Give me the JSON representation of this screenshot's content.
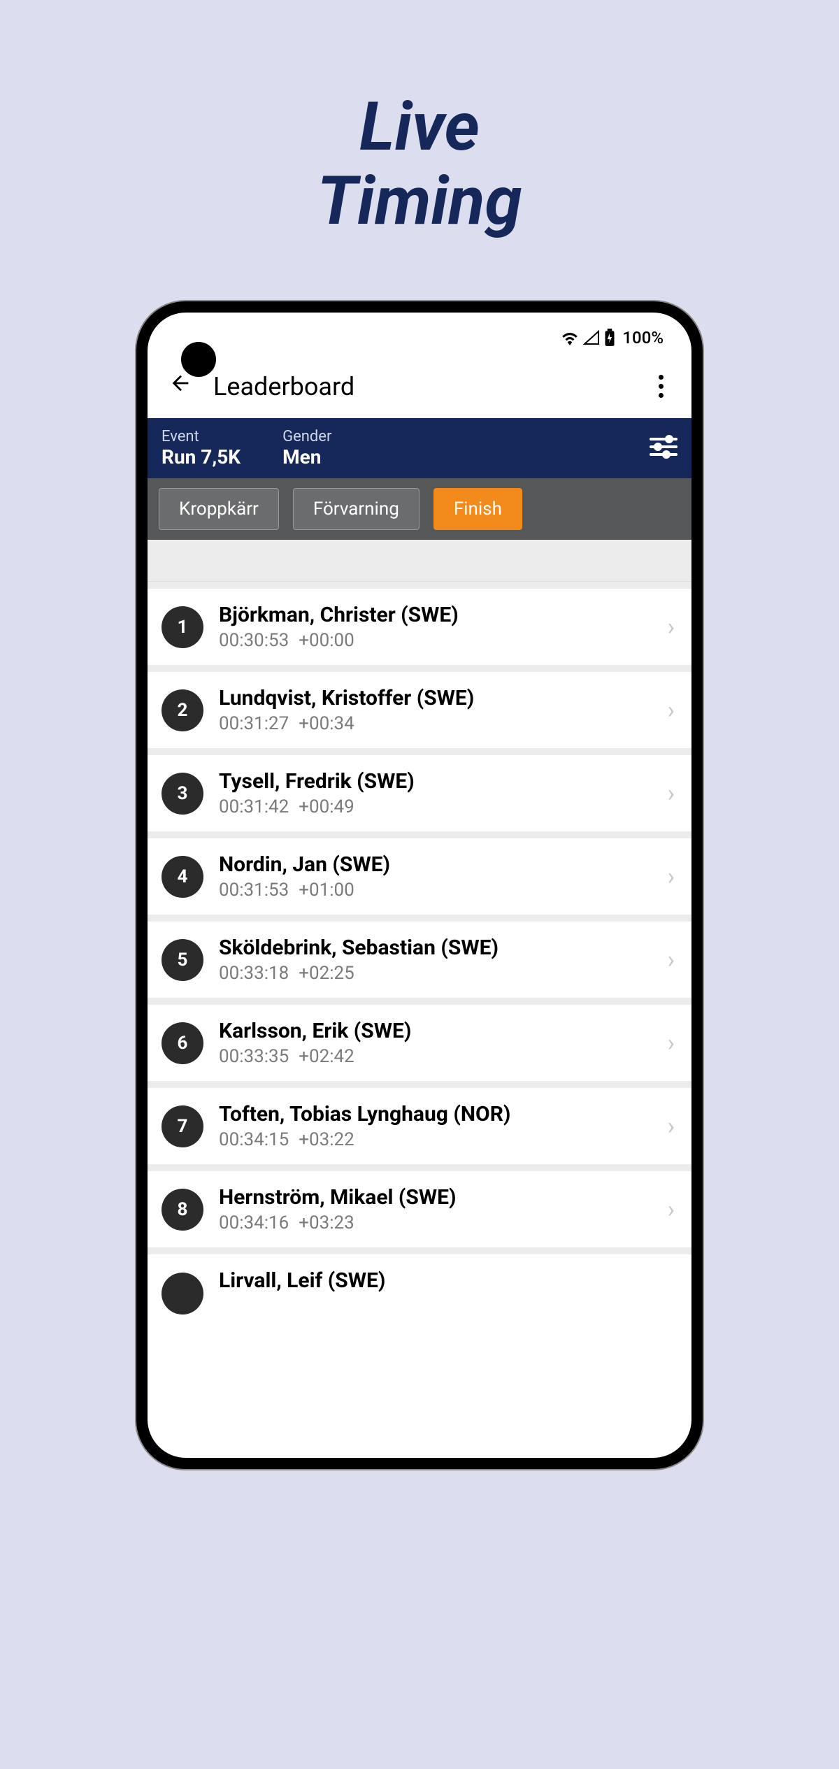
{
  "promo": {
    "line1": "Live",
    "line2": "Timing"
  },
  "status": {
    "battery": "100%"
  },
  "appbar": {
    "title": "Leaderboard"
  },
  "filters": {
    "event_label": "Event",
    "event_value": "Run 7,5K",
    "gender_label": "Gender",
    "gender_value": "Men"
  },
  "tabs": [
    {
      "label": "Kroppkärr",
      "active": false
    },
    {
      "label": "Förvarning",
      "active": false
    },
    {
      "label": "Finish",
      "active": true
    }
  ],
  "results": [
    {
      "rank": "1",
      "name": "Björkman, Christer (SWE)",
      "time": "00:30:53",
      "diff": "+00:00"
    },
    {
      "rank": "2",
      "name": "Lundqvist, Kristoffer (SWE)",
      "time": "00:31:27",
      "diff": "+00:34"
    },
    {
      "rank": "3",
      "name": "Tysell, Fredrik (SWE)",
      "time": "00:31:42",
      "diff": "+00:49"
    },
    {
      "rank": "4",
      "name": "Nordin, Jan (SWE)",
      "time": "00:31:53",
      "diff": "+01:00"
    },
    {
      "rank": "5",
      "name": "Sköldebrink, Sebastian (SWE)",
      "time": "00:33:18",
      "diff": "+02:25"
    },
    {
      "rank": "6",
      "name": "Karlsson, Erik (SWE)",
      "time": "00:33:35",
      "diff": "+02:42"
    },
    {
      "rank": "7",
      "name": "Toften, Tobias Lynghaug (NOR)",
      "time": "00:34:15",
      "diff": "+03:22"
    },
    {
      "rank": "8",
      "name": "Hernström, Mikael (SWE)",
      "time": "00:34:16",
      "diff": "+03:23"
    }
  ],
  "partial": {
    "name": "Lirvall, Leif (SWE)"
  }
}
